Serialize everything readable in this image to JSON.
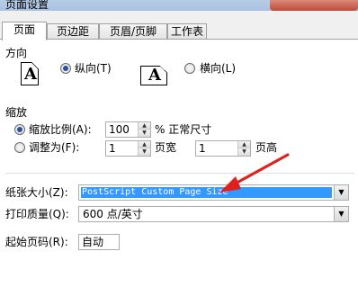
{
  "window": {
    "title": "页面设置"
  },
  "tabs": [
    {
      "label": "页面"
    },
    {
      "label": "页边距"
    },
    {
      "label": "页眉/页脚"
    },
    {
      "label": "工作表"
    }
  ],
  "orientation": {
    "heading": "方向",
    "portrait_label": "纵向(T)",
    "landscape_label": "横向(L)",
    "icon_letter": "A",
    "selected": "portrait"
  },
  "scaling": {
    "heading": "缩放",
    "adjust_to_label": "缩放比例(A):",
    "adjust_value": "100",
    "percent_suffix": "% 正常尺寸",
    "fit_to_label": "调整为(F):",
    "pages_wide_value": "1",
    "pages_wide_label": "页宽",
    "pages_tall_value": "1",
    "pages_tall_label": "页高",
    "selected": "adjust_to"
  },
  "paper_size": {
    "label": "纸张大小(Z):",
    "value": "PostScript Custom Page Size"
  },
  "print_quality": {
    "label": "打印质量(Q):",
    "value": "600 点/英寸"
  },
  "first_page_number": {
    "label": "起始页码(R):",
    "value": "自动"
  },
  "colors": {
    "selection": "#3399ff",
    "annotation_arrow": "#e0201c"
  }
}
